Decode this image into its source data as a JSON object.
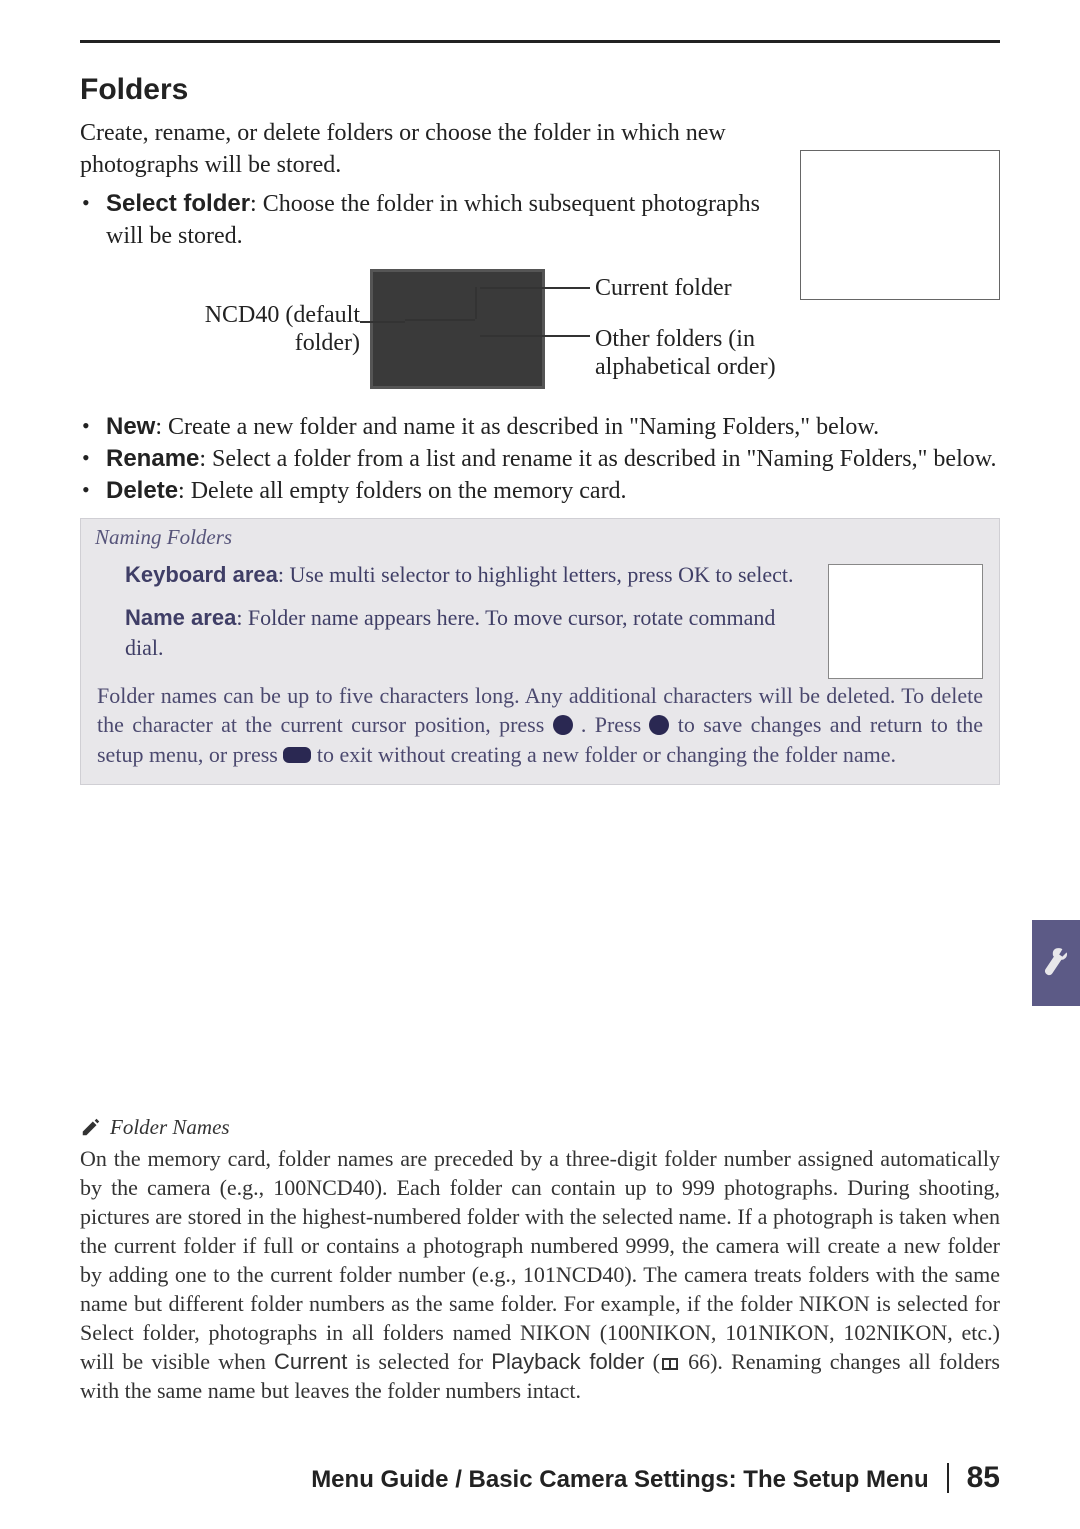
{
  "section_title": "Folders",
  "intro": "Create, rename, or delete folders or choose the folder in which new photographs will be stored.",
  "bullets_top": [
    {
      "label": "Select folder",
      "text": ": Choose the folder in which subsequent photographs will be stored."
    }
  ],
  "diagram": {
    "left_label": "NCD40 (default folder)",
    "right_label_1": "Current folder",
    "right_label_2": "Other folders (in alphabetical order)"
  },
  "bullets_mid": [
    {
      "label": "New",
      "text": ": Create a new folder and name it as described in \"Naming Folders,\" below."
    },
    {
      "label": "Rename",
      "text": ": Select a folder from a list and rename it as described in \"Naming Folders,\" below."
    },
    {
      "label": "Delete",
      "text": ": Delete all empty folders on the memory card."
    }
  ],
  "naming": {
    "title": "Naming Folders",
    "row1_label": "Keyboard area",
    "row1_text": ": Use multi selector to highlight letters, press OK to select.",
    "row2_label": "Name area",
    "row2_text": ": Folder name appears here.  To move cursor, rotate command dial.",
    "footer_pre": "Folder names can be up to five characters long.  Any additional characters will be deleted.  To delete the character at the current cursor position, press ",
    "footer_mid": ".  Press ",
    "footer_post": " to save changes and return to the setup menu, or press ",
    "footer_end": " to exit without creating a new folder or changing the folder name."
  },
  "footnote": {
    "title": "Folder Names",
    "body_pre": "On the memory card, folder names are preceded by a three-digit folder number assigned automatically by the camera (e.g., 100NCD40).  Each folder can contain up to 999 photographs.  During shooting, pictures are stored in the highest-numbered folder with the selected name.  If a photograph is taken when the current folder if full or contains a photograph numbered 9999, the camera will create a new folder by adding one to the current folder number (e.g., 101NCD40).  The camera treats folders with the same name but different folder numbers as the same folder.  For example, if the folder NIKON is selected for Select folder, photographs in all folders named NIKON (100NIKON, 101NIKON, 102NIKON, etc.) will be visible when ",
    "body_current": "Current",
    "body_mid": " is selected for ",
    "body_pb": "Playback folder",
    "body_ref": " 66).  Renaming changes all folders with the same name but leaves the folder numbers intact."
  },
  "footer": {
    "title": "Menu Guide / Basic Camera Settings: The Setup Menu",
    "page": "85"
  }
}
